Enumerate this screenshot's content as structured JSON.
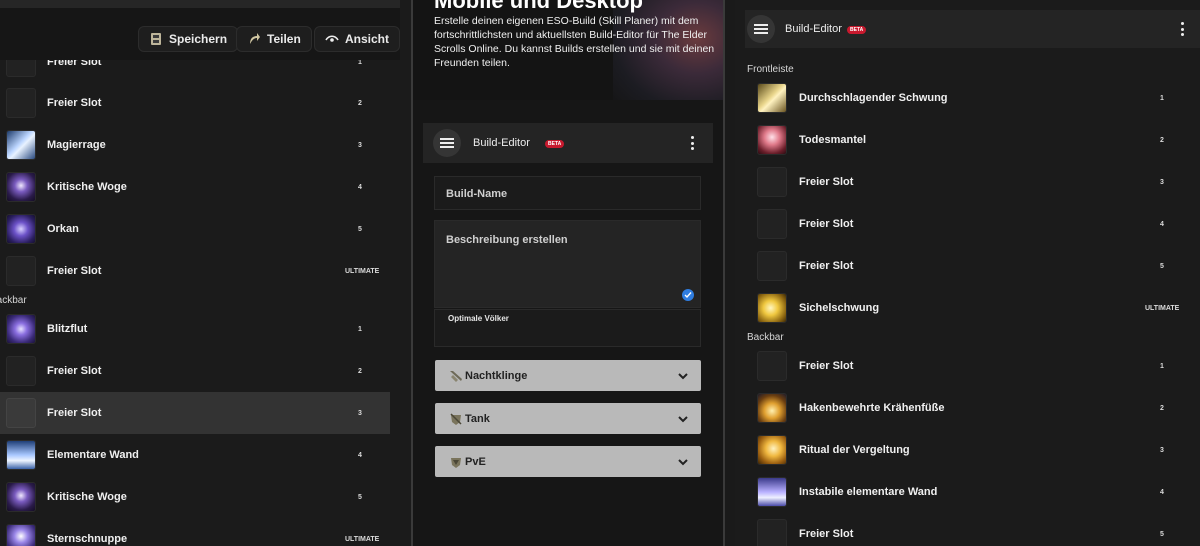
{
  "left": {
    "toolbar": {
      "save_label": "Speichern",
      "share_label": "Teilen",
      "view_label": "Ansicht"
    },
    "front_slots": [
      {
        "name": "Freier Slot",
        "num": "1",
        "icon": "empty-slot"
      },
      {
        "name": "Freier Slot",
        "num": "2",
        "icon": "empty-slot"
      },
      {
        "name": "Magierrage",
        "num": "3",
        "icon": "mages-wrath-icon"
      },
      {
        "name": "Kritische Woge",
        "num": "4",
        "icon": "critical-surge-icon"
      },
      {
        "name": "Orkan",
        "num": "5",
        "icon": "hurricane-icon"
      },
      {
        "name": "Freier Slot",
        "num": "ULTIMATE",
        "icon": "empty-slot"
      }
    ],
    "backbar_label": "Backbar",
    "back_slots": [
      {
        "name": "Blitzflut",
        "num": "1",
        "icon": "lightning-flood-icon"
      },
      {
        "name": "Freier Slot",
        "num": "2",
        "icon": "empty-slot"
      },
      {
        "name": "Freier Slot",
        "num": "3",
        "icon": "empty-slot"
      },
      {
        "name": "Elementare Wand",
        "num": "4",
        "icon": "elemental-wall-icon"
      },
      {
        "name": "Kritische Woge",
        "num": "5",
        "icon": "critical-surge-icon"
      },
      {
        "name": "Sternschnuppe",
        "num": "ULTIMATE",
        "icon": "shooting-star-icon"
      }
    ]
  },
  "middle": {
    "hero_title": "Mobile und Desktop",
    "hero_text": "Erstelle deinen eigenen ESO-Build (Skill Planer) mit dem fortschrittlichsten und aktuellsten Build-Editor für The Elder Scrolls Online. Du kannst Builds erstellen und sie mit deinen Freunden teilen.",
    "editor_title": "Build-Editor",
    "beta_label": "BETA",
    "build_name_placeholder": "Build-Name",
    "description_placeholder": "Beschreibung erstellen",
    "races_label": "Optimale Völker",
    "accordions": [
      {
        "label": "Nachtklinge",
        "icon": "nightblade-icon"
      },
      {
        "label": "Tank",
        "icon": "tank-icon"
      },
      {
        "label": "PvE",
        "icon": "pve-icon"
      }
    ]
  },
  "right": {
    "editor_title": "Build-Editor",
    "beta_label": "BETA",
    "frontbar_label": "Frontleiste",
    "front_slots": [
      {
        "name": "Durchschlagender Schwung",
        "num": "1",
        "icon": "piercing-sweep-icon"
      },
      {
        "name": "Todesmantel",
        "num": "2",
        "icon": "death-cloak-icon"
      },
      {
        "name": "Freier Slot",
        "num": "3",
        "icon": "empty-slot"
      },
      {
        "name": "Freier Slot",
        "num": "4",
        "icon": "empty-slot"
      },
      {
        "name": "Freier Slot",
        "num": "5",
        "icon": "empty-slot"
      },
      {
        "name": "Sichelschwung",
        "num": "ULTIMATE",
        "icon": "crescent-sweep-icon"
      }
    ],
    "backbar_label": "Backbar",
    "back_slots": [
      {
        "name": "Freier Slot",
        "num": "1",
        "icon": "empty-slot"
      },
      {
        "name": "Hakenbewehrte Krähenfüße",
        "num": "2",
        "icon": "caltrops-icon"
      },
      {
        "name": "Ritual der Vergeltung",
        "num": "3",
        "icon": "ritual-retribution-icon"
      },
      {
        "name": "Instabile elementare Wand",
        "num": "4",
        "icon": "unstable-wall-icon"
      },
      {
        "name": "Freier Slot",
        "num": "5",
        "icon": "empty-slot"
      }
    ]
  },
  "colors": {
    "accent_blue": "#2f7de0",
    "beta_red": "#c8192e",
    "accordion_bg": "#b9b9b9"
  }
}
